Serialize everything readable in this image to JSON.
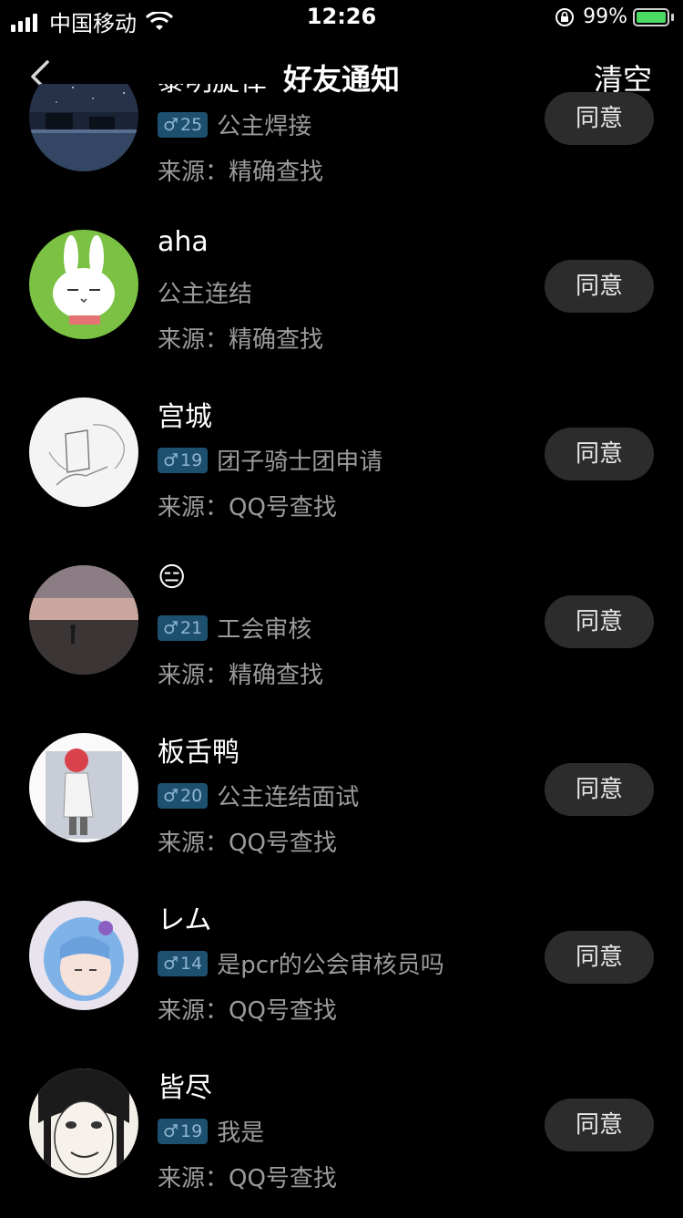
{
  "status_bar": {
    "carrier": "中国移动",
    "time": "12:26",
    "battery": "99%"
  },
  "nav": {
    "title": "好友通知",
    "clear": "清空"
  },
  "requests": [
    {
      "name": "黎明旋律",
      "age": "25",
      "message": "公主焊接",
      "source": "来源：精确查找",
      "button": "同意",
      "avatar": "night-lake-avatar"
    },
    {
      "name": "aha",
      "age": "",
      "message": "公主连结",
      "source": "来源：精确查找",
      "button": "同意",
      "avatar": "bunny-avatar"
    },
    {
      "name": "宫城",
      "age": "19",
      "message": "团子骑士团申请",
      "source": "来源：QQ号查找",
      "button": "同意",
      "avatar": "sketch-avatar"
    },
    {
      "name": "😑",
      "age": "21",
      "message": "工会审核",
      "source": "来源：精确查找",
      "button": "同意",
      "avatar": "dusk-landscape-avatar"
    },
    {
      "name": "板舌鸭",
      "age": "20",
      "message": "公主连结面试",
      "source": "来源：QQ号查找",
      "button": "同意",
      "avatar": "red-head-figure-avatar"
    },
    {
      "name": "レム",
      "age": "14",
      "message": "是pcr的公会审核员吗",
      "source": "来源：QQ号查找",
      "button": "同意",
      "avatar": "anime-girl-avatar"
    },
    {
      "name": "皆尽",
      "age": "19",
      "message": "我是",
      "source": "来源：QQ号查找",
      "button": "同意",
      "avatar": "manga-face-avatar"
    }
  ]
}
